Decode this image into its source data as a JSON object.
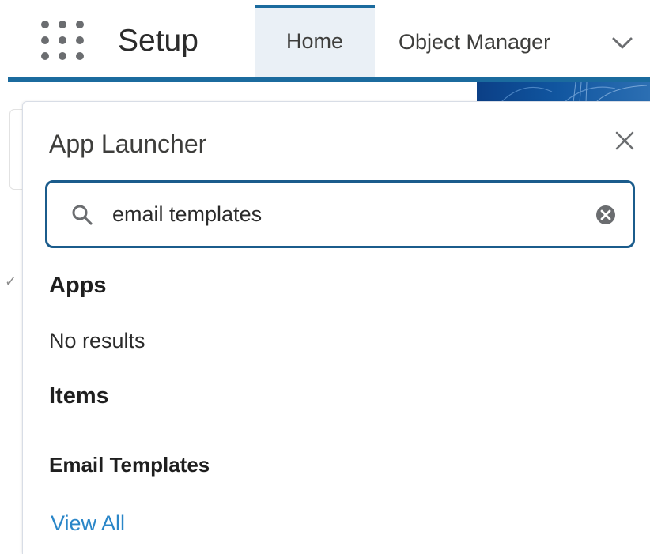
{
  "header": {
    "app_name": "Setup",
    "tabs": [
      {
        "label": "Home",
        "active": true
      },
      {
        "label": "Object Manager",
        "active": false
      }
    ],
    "accent_color": "#1b6b9e"
  },
  "app_launcher": {
    "title": "App Launcher",
    "search": {
      "value": "email templates"
    },
    "sections": {
      "apps": {
        "heading": "Apps",
        "empty_text": "No results"
      },
      "items": {
        "heading": "Items",
        "results": [
          "Email Templates"
        ]
      }
    },
    "view_all_label": "View All",
    "link_color": "#2a86c8"
  },
  "icons": {
    "launcher": "app-launcher-waffle-icon",
    "tab_menu": "chevron-down-icon",
    "close": "close-icon",
    "search": "search-icon",
    "clear": "clear-search-icon"
  }
}
